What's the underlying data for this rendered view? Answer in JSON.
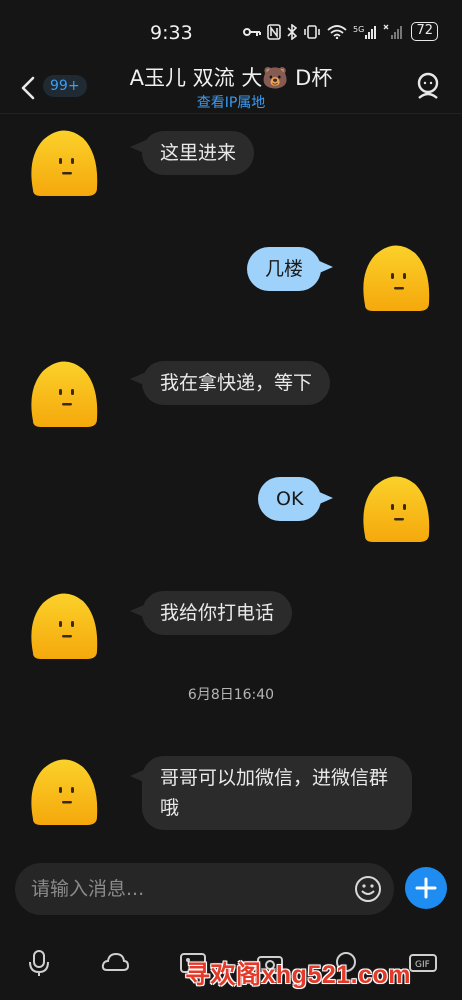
{
  "status": {
    "time": "9:33",
    "network": "5G",
    "battery": "72"
  },
  "header": {
    "unread": "99+",
    "title": "A玉儿 双流 大🐻 D杯",
    "subtitle": "查看IP属地"
  },
  "messages": [
    {
      "from": "peer",
      "text": "这里进来"
    },
    {
      "from": "me",
      "text": "几楼"
    },
    {
      "from": "peer",
      "text": "我在拿快递，等下"
    },
    {
      "from": "me",
      "text": "OK"
    },
    {
      "from": "peer",
      "text": "我给你打电话"
    },
    {
      "from": "peer",
      "text": "哥哥可以加微信，进微信群哦"
    }
  ],
  "timestamp": "6月8日16:40",
  "input": {
    "placeholder": "请输入消息..."
  },
  "watermark": "寻欢阁xhg521.com",
  "colors": {
    "accent": "#1e8cf0",
    "out_bubble": "#9fd2fb",
    "in_bubble": "#2b2b2b",
    "avatar": "#f7c512"
  }
}
